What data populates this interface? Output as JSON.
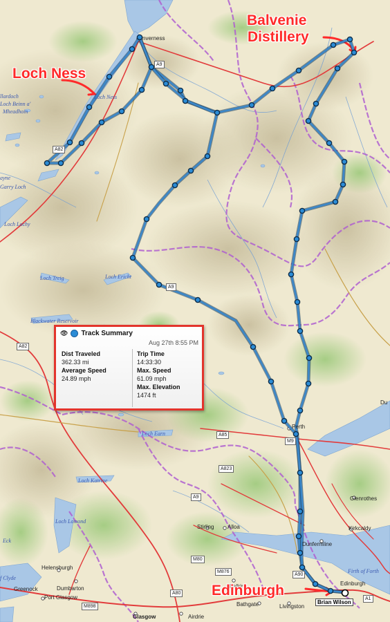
{
  "annotations": {
    "loch_ness": "Loch Ness",
    "balvenie_line1": "Balvenie",
    "balvenie_line2": "Distillery",
    "edinburgh": "Edinburgh"
  },
  "track_summary": {
    "title": "Track Summary",
    "date": "Aug 27th 8:55 PM",
    "dist_label": "Dist Traveled",
    "dist_value": "362.33 mi",
    "avg_label": "Average Speed",
    "avg_value": "24.89 mph",
    "trip_label": "Trip Time",
    "trip_value": "14:33:30",
    "maxspeed_label": "Max. Speed",
    "maxspeed_value": "61.09 mph",
    "maxelev_label": "Max. Elevation",
    "maxelev_value": "1474 ft"
  },
  "places": {
    "inverness": "nverness",
    "perth": "Perth",
    "stirling": "Stirling",
    "alloa": "Alloa",
    "dunfermline": "Dunfermline",
    "glenrothes": "Glenrothes",
    "kirkcaldy": "Kirkcaldy",
    "helensburgh": "Helensburgh",
    "dumbarton": "Dumbarton",
    "greenock": "Greenock",
    "port_glasgow": "Port Glasgow",
    "glasgow": "Glasgow",
    "airdrie": "Airdrie",
    "falkirk": "Falkirk",
    "bathgate": "Bathgate",
    "livingston": "Livingston",
    "edinburgh_map": "Edinburgh",
    "du": "Du",
    "brian": "Brian Wilson"
  },
  "water": {
    "loch_ness": "Loch Ness",
    "llardoch": "llardoch",
    "loch_beinn": "Loch Beinn a'",
    "mheadhoin": "Mheadhoin",
    "ayne": "ayne",
    "garry": "Garry Loch",
    "lochy": "Loch Lochy",
    "treig": "Loch Treig",
    "ericht": "Loch Ericht",
    "blackwater": "Blackwater Reservoir",
    "earn": "Loch Earn",
    "katrine": "Loch Katrine",
    "lomond": "Loch Lomond",
    "firth_forth": "Firth of Forth",
    "firth_clyde": "f Clyde",
    "eck": "Eck"
  },
  "roads": {
    "a9_top": "A9",
    "a82": "A82",
    "a82_mid": "A82",
    "a9_mid": "A9",
    "a85": "A85",
    "m9": "M9",
    "a823": "A823",
    "a9_low": "A9",
    "m80": "M80",
    "m876": "M876",
    "a90": "A90",
    "a80": "A80",
    "m898": "M898",
    "a1": "A1"
  },
  "colors": {
    "land": "#efe9d0",
    "water": "#a9c7e6",
    "track": "#3b87c9",
    "track_dark": "#123a5c",
    "annotation": "#ff2a2a",
    "border": "#b060d0",
    "road_major": "#e23b3b",
    "road_minor": "#c8a14a"
  }
}
